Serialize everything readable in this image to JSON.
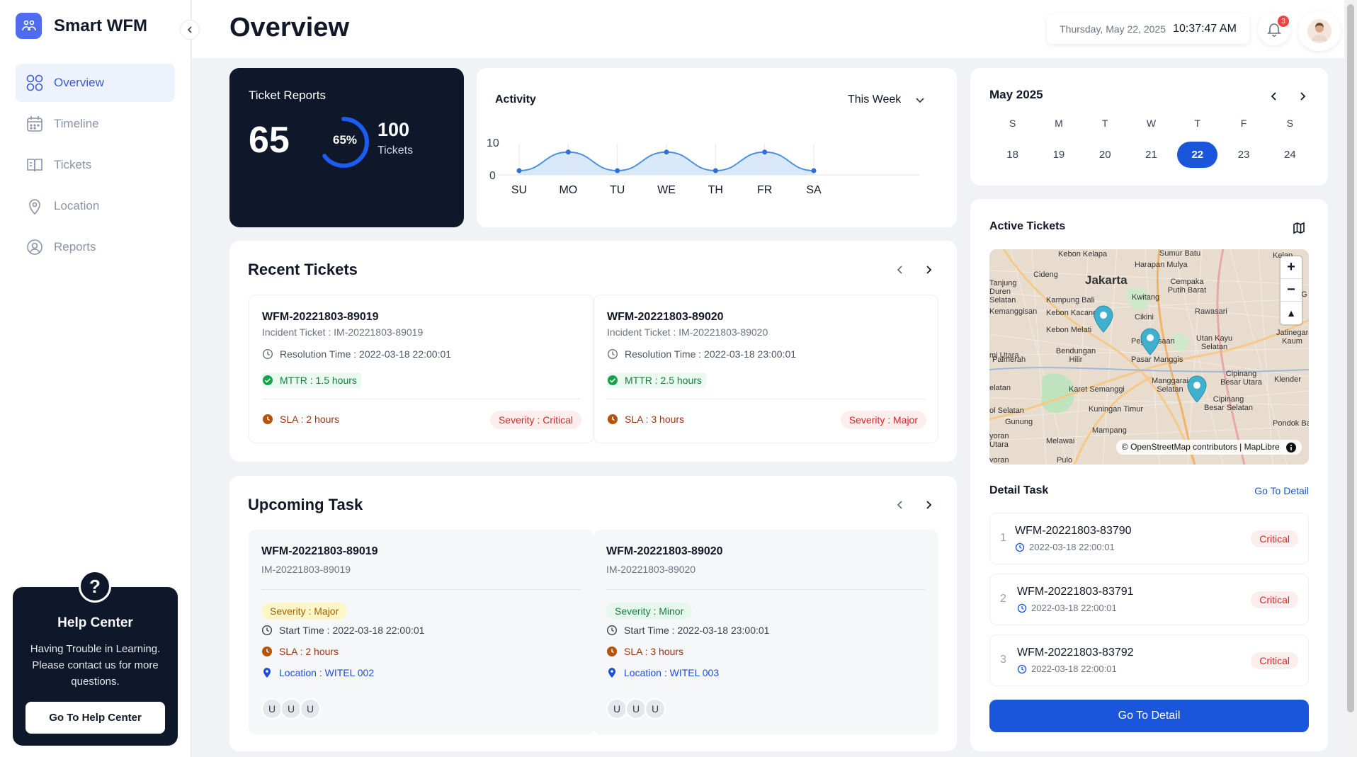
{
  "brand": {
    "name": "Smart WFM"
  },
  "nav": [
    {
      "label": "Overview",
      "icon": "grid-icon",
      "active": true
    },
    {
      "label": "Timeline",
      "icon": "calendar-icon",
      "active": false
    },
    {
      "label": "Tickets",
      "icon": "book-icon",
      "active": false
    },
    {
      "label": "Location",
      "icon": "pin-icon",
      "active": false
    },
    {
      "label": "Reports",
      "icon": "user-circle-icon",
      "active": false
    }
  ],
  "help": {
    "title": "Help Center",
    "text": "Having Trouble in Learning. Please contact us for more questions.",
    "button": "Go To Help Center"
  },
  "header": {
    "title": "Overview",
    "date": "Thursday, May 22, 2025",
    "time": "10:37:47 AM",
    "notifications": "3"
  },
  "ticket_reports": {
    "title": "Ticket Reports",
    "count": "65",
    "percent": "65%",
    "percent_value": 0.65,
    "total": "100",
    "total_label": "Tickets"
  },
  "activity": {
    "title": "Activity",
    "period": "This Week"
  },
  "chart_data": {
    "type": "area",
    "categories": [
      "SU",
      "MO",
      "TU",
      "WE",
      "TH",
      "FR",
      "SA"
    ],
    "series": [
      {
        "values": [
          0,
          5,
          0,
          5,
          0,
          5,
          0
        ]
      }
    ],
    "ylim": [
      0,
      10
    ],
    "yticks": [
      "0",
      "10"
    ],
    "color": "#4a90e2"
  },
  "recent": {
    "title": "Recent Tickets",
    "tickets": [
      {
        "id": "WFM-20221803-89019",
        "incident": "Incident Ticket : IM-20221803-89019",
        "resolution": "Resolution Time : 2022-03-18 22:00:01",
        "mttr": "MTTR : 1.5 hours",
        "sla": "SLA : 2 hours",
        "severity": "Severity : Critical"
      },
      {
        "id": "WFM-20221803-89020",
        "incident": "Incident Ticket : IM-20221803-89020",
        "resolution": "Resolution Time : 2022-03-18 23:00:01",
        "mttr": "MTTR : 2.5 hours",
        "sla": "SLA : 3 hours",
        "severity": "Severity : Major"
      }
    ]
  },
  "upcoming": {
    "title": "Upcoming Task",
    "tasks": [
      {
        "id": "WFM-20221803-89019",
        "incident": "IM-20221803-89019",
        "severity": "Severity : Major",
        "start": "Start Time : 2022-03-18 22:00:01",
        "sla": "SLA : 2 hours",
        "location": "Location : WITEL 002",
        "avatars": [
          "U",
          "U",
          "U"
        ]
      },
      {
        "id": "WFM-20221803-89020",
        "incident": "IM-20221803-89020",
        "severity": "Severity : Minor",
        "start": "Start Time : 2022-03-18 23:00:01",
        "sla": "SLA : 3 hours",
        "location": "Location : WITEL 003",
        "avatars": [
          "U",
          "U",
          "U"
        ]
      }
    ]
  },
  "calendar": {
    "title": "May 2025",
    "dow": [
      "S",
      "M",
      "T",
      "W",
      "T",
      "F",
      "S"
    ],
    "days": [
      "18",
      "19",
      "20",
      "21",
      "22",
      "23",
      "24"
    ],
    "selected": "22"
  },
  "active_tickets": {
    "title": "Active Tickets",
    "map_labels": [
      "Kebon Kelapa",
      "Sumur Batu",
      "Kelap",
      "Harapan Mulya",
      "Cideng",
      "Jakarta",
      "Tanjung Duren Selatan",
      "Cempaka Putih Barat",
      "Kampung Bali",
      "Kwitang",
      "Pulo G",
      "Kemanggisan",
      "Kebon Kacang",
      "Rawasari",
      "Kebon Melati",
      "Cikini",
      "Utan Kayu Selatan",
      "Jatinegara Kaum",
      "Bendungan Hilir",
      "Pegangsaan",
      "Palmerah",
      "Pasar Manggis",
      "mi Utara",
      "Cipinang Besar Utara",
      "Klender",
      "Manggarai Selatan",
      "elatan",
      "Karet Semanggi",
      "Kuningan Timur",
      "Cipinang Besar Selatan",
      "ol Selatan",
      "Gunung",
      "Pondok Bambu",
      "Mampang",
      "Melawai",
      "yoran Utara",
      "Pulo",
      "yoran"
    ],
    "attribution": "© OpenStreetMap contributors | MapLibre",
    "zoom_in": "+",
    "zoom_out": "−",
    "compass": "▲"
  },
  "detail_task": {
    "title": "Detail Task",
    "link": "Go To Detail",
    "items": [
      {
        "num": "1",
        "id": "WFM-20221803-83790",
        "time": "2022-03-18 22:00:01",
        "badge": "Critical"
      },
      {
        "num": "2",
        "id": "WFM-20221803-83791",
        "time": "2022-03-18 22:00:01",
        "badge": "Critical"
      },
      {
        "num": "3",
        "id": "WFM-20221803-83792",
        "time": "2022-03-18 22:00:01",
        "badge": "Critical"
      }
    ],
    "button": "Go To Detail"
  }
}
